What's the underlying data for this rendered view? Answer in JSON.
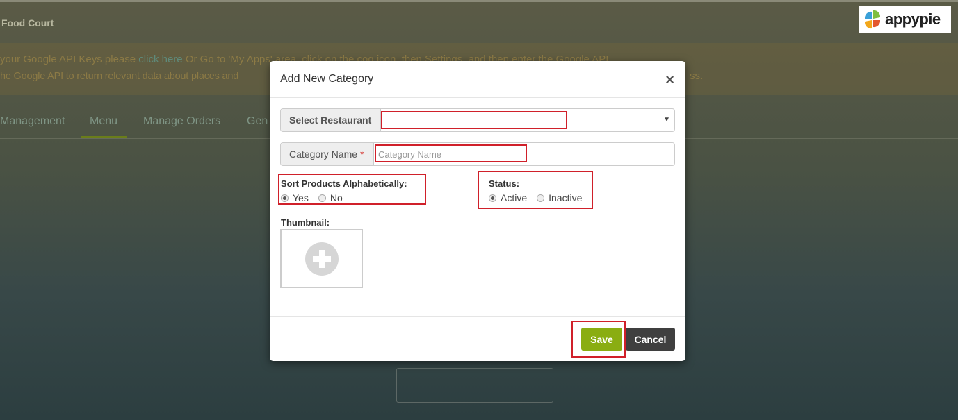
{
  "app": {
    "title": "Food Court"
  },
  "logo": {
    "text": "appypie"
  },
  "notice": {
    "line1_pre": "your Google API Keys please ",
    "line1_link": "click here",
    "line1_post": " Or Go to 'My Apps' area, click on the cog icon, then Settings, and then enter the Google API",
    "line2": "he Google API to return relevant data about places and",
    "line2_end": "ss."
  },
  "tabs": [
    {
      "label": "Management"
    },
    {
      "label": "Menu",
      "active": true
    },
    {
      "label": "Manage Orders"
    },
    {
      "label": "Gen"
    }
  ],
  "modal": {
    "title": "Add New Category",
    "select_restaurant_label": "Select Restaurant",
    "select_restaurant_value": "",
    "category_name_label": "Category Name",
    "required_mark": "*",
    "category_name_placeholder": "Category Name",
    "category_name_value": "",
    "sort_label": "Sort Products Alphabetically:",
    "sort_options": [
      {
        "label": "Yes",
        "checked": true
      },
      {
        "label": "No",
        "checked": false
      }
    ],
    "status_label": "Status:",
    "status_options": [
      {
        "label": "Active",
        "checked": true
      },
      {
        "label": "Inactive",
        "checked": false
      }
    ],
    "thumbnail_label": "Thumbnail:",
    "save_label": "Save",
    "cancel_label": "Cancel"
  },
  "colors": {
    "highlight": "#d0202a",
    "save": "#8aad12",
    "cancel": "#3f3f3f",
    "active_tab": "#8bb31d"
  }
}
